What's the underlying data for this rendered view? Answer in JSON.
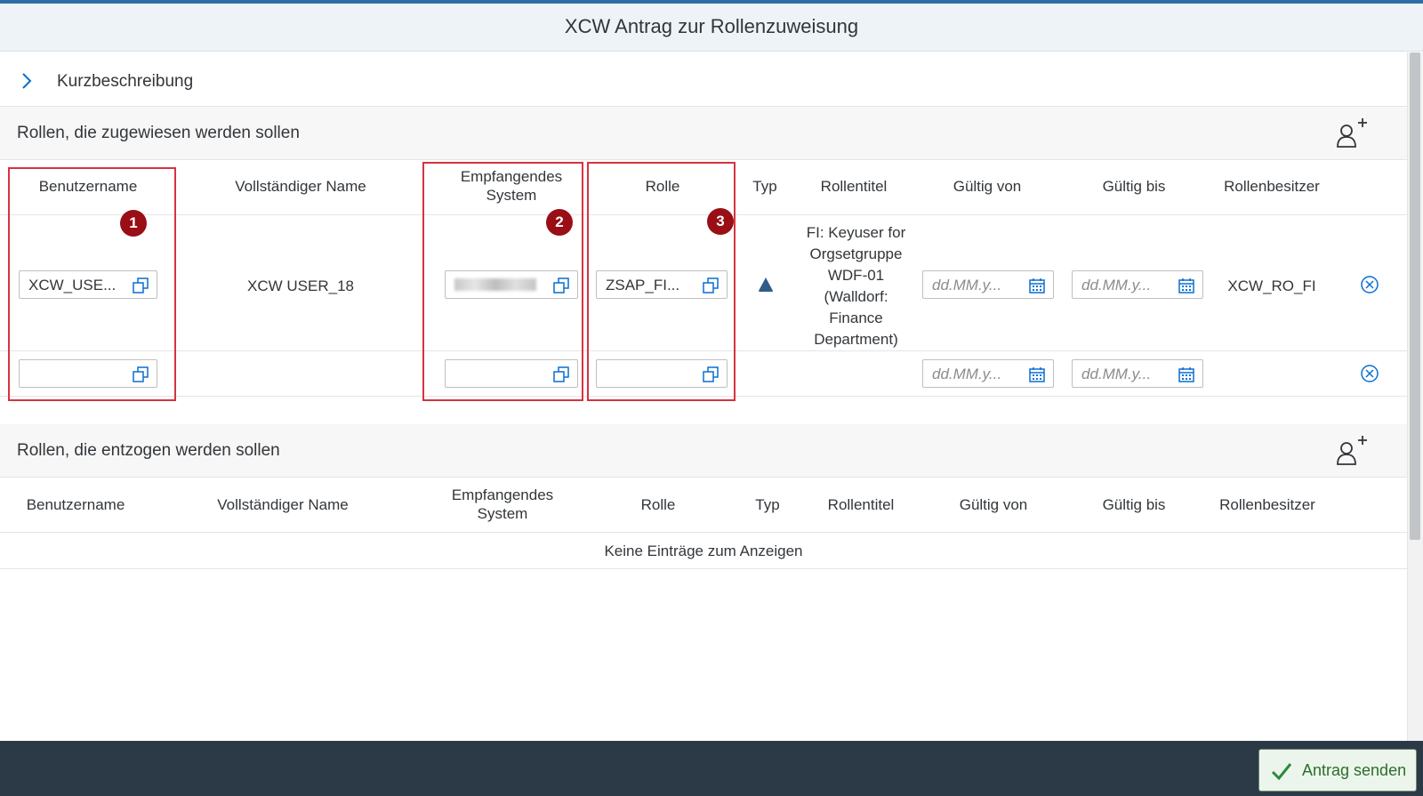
{
  "dialog": {
    "title": "XCW Antrag zur Rollenzuweisung"
  },
  "short_description": {
    "label": "Kurzbeschreibung"
  },
  "assign_section": {
    "title": "Rollen, die zugewiesen werden sollen",
    "columns": {
      "benutzername": "Benutzername",
      "vollstaendiger_name": "Vollständiger Name",
      "empfangendes_system_1": "Empfangendes",
      "empfangendes_system_2": "System",
      "rolle": "Rolle",
      "typ": "Typ",
      "rollentitel": "Rollentitel",
      "gueltig_von": "Gültig von",
      "gueltig_bis": "Gültig bis",
      "rollenbesitzer": "Rollenbesitzer"
    },
    "rows": [
      {
        "benutzername": "XCW_USE...",
        "vollstaendiger_name": "XCW USER_18",
        "empfangendes_system": "",
        "rolle": "ZSAP_FI...",
        "rollentitel_lines": [
          "FI: Keyuser for",
          "Orgsetgruppe",
          "WDF-01",
          "(Walldorf:",
          "Finance",
          "Department)"
        ],
        "gueltig_von_placeholder": "dd.MM.y...",
        "gueltig_bis_placeholder": "dd.MM.y...",
        "rollenbesitzer": "XCW_RO_FI"
      },
      {
        "benutzername": "",
        "vollstaendiger_name": "",
        "empfangendes_system": "",
        "rolle": "",
        "gueltig_von_placeholder": "dd.MM.y...",
        "gueltig_bis_placeholder": "dd.MM.y...",
        "rollenbesitzer": ""
      }
    ],
    "badges": [
      "1",
      "2",
      "3"
    ]
  },
  "revoke_section": {
    "title": "Rollen, die entzogen werden sollen",
    "columns": {
      "benutzername": "Benutzername",
      "vollstaendiger_name": "Vollständiger Name",
      "empfangendes_system_1": "Empfangendes",
      "empfangendes_system_2": "System",
      "rolle": "Rolle",
      "typ": "Typ",
      "rollentitel": "Rollentitel",
      "gueltig_von": "Gültig von",
      "gueltig_bis": "Gültig bis",
      "rollenbesitzer": "Rollenbesitzer"
    },
    "empty_text": "Keine Einträge zum Anzeigen"
  },
  "footer": {
    "send_label": "Antrag senden"
  },
  "colors": {
    "accent": "#0a6ed1",
    "badge": "#9a0e16",
    "highlight": "#d6333f",
    "footer": "#2c3a47"
  },
  "icons": {
    "value_help": "value-help-icon",
    "calendar": "calendar-icon",
    "delete": "delete-icon",
    "add_user": "add-user-icon",
    "expand": "chevron-right-icon",
    "type": "triangle-icon",
    "send": "checkmark-icon"
  }
}
